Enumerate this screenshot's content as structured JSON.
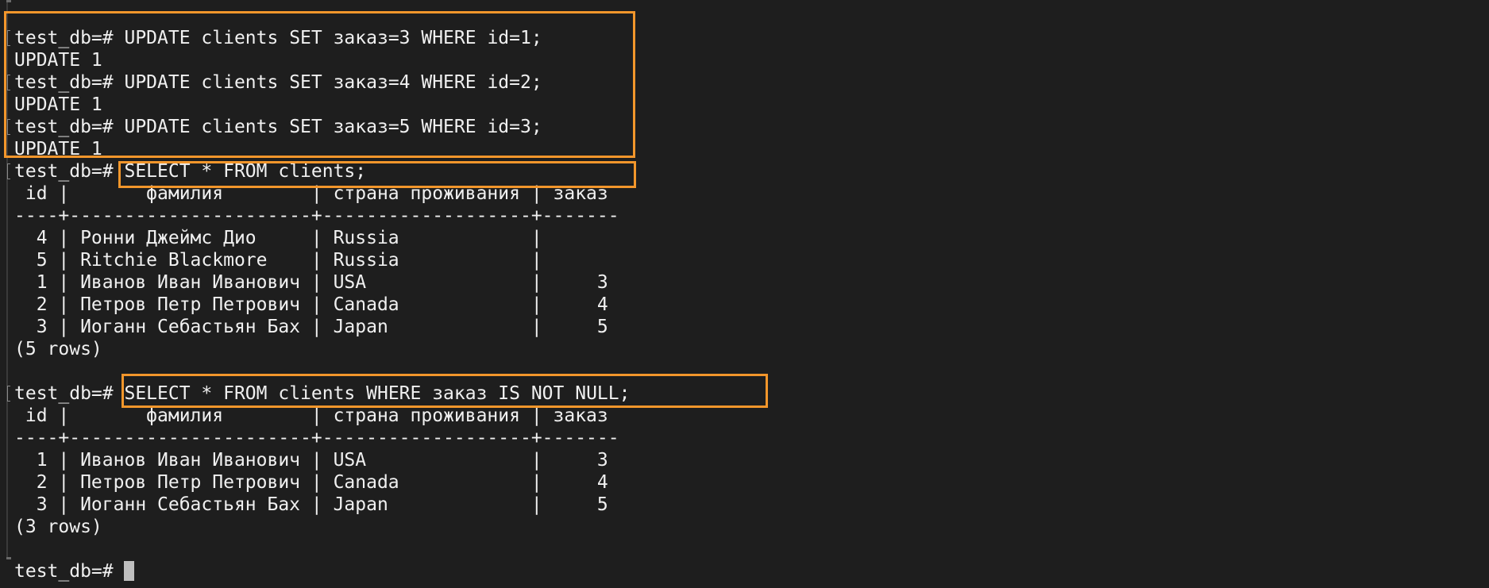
{
  "terminal": {
    "lines": [
      {
        "kind": "prompt",
        "prompt": "test_db=# ",
        "command": "UPDATE clients SET заказ=3 WHERE id=1;"
      },
      {
        "kind": "output",
        "text": "UPDATE 1"
      },
      {
        "kind": "prompt",
        "prompt": "test_db=# ",
        "command": "UPDATE clients SET заказ=4 WHERE id=2;"
      },
      {
        "kind": "output",
        "text": "UPDATE 1"
      },
      {
        "kind": "prompt",
        "prompt": "test_db=# ",
        "command": "UPDATE clients SET заказ=5 WHERE id=3;"
      },
      {
        "kind": "output",
        "text": "UPDATE 1"
      },
      {
        "kind": "prompt",
        "prompt": "test_db=# ",
        "command": "SELECT * FROM clients;"
      },
      {
        "kind": "output",
        "text": " id |       фамилия        | страна проживания | заказ"
      },
      {
        "kind": "output",
        "text": "----+----------------------+-------------------+-------"
      },
      {
        "kind": "output",
        "text": "  4 | Ронни Джеймс Дио     | Russia            |"
      },
      {
        "kind": "output",
        "text": "  5 | Ritchie Blackmore    | Russia            |"
      },
      {
        "kind": "output",
        "text": "  1 | Иванов Иван Иванович | USA               |     3"
      },
      {
        "kind": "output",
        "text": "  2 | Петров Петр Петрович | Canada            |     4"
      },
      {
        "kind": "output",
        "text": "  3 | Иоганн Себастьян Бах | Japan             |     5"
      },
      {
        "kind": "output",
        "text": "(5 rows)"
      },
      {
        "kind": "output",
        "text": ""
      },
      {
        "kind": "prompt",
        "prompt": "test_db=# ",
        "command": "SELECT * FROM clients WHERE заказ IS NOT NULL;"
      },
      {
        "kind": "output",
        "text": " id |       фамилия        | страна проживания | заказ"
      },
      {
        "kind": "output",
        "text": "----+----------------------+-------------------+-------"
      },
      {
        "kind": "output",
        "text": "  1 | Иванов Иван Иванович | USA               |     3"
      },
      {
        "kind": "output",
        "text": "  2 | Петров Петр Петрович | Canada            |     4"
      },
      {
        "kind": "output",
        "text": "  3 | Иоганн Себастьян Бах | Japan             |     5"
      },
      {
        "kind": "output",
        "text": "(3 rows)"
      },
      {
        "kind": "output",
        "text": ""
      },
      {
        "kind": "current",
        "prompt": "test_db=# ",
        "command": ""
      }
    ]
  },
  "colors": {
    "background": "#1e1e1e",
    "text": "#f0f0f0",
    "highlight": "#f2962b",
    "cursor": "#bfbfbf"
  }
}
